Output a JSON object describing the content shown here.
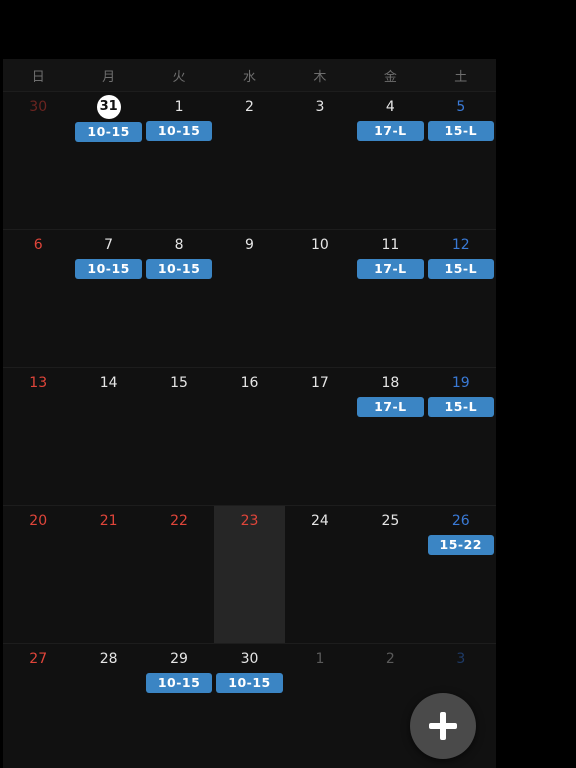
{
  "weekdays": [
    "日",
    "月",
    "火",
    "水",
    "木",
    "金",
    "土"
  ],
  "weeks": [
    [
      {
        "day": "30",
        "type": "other-sun",
        "events": []
      },
      {
        "day": "31",
        "type": "today",
        "events": [
          "10-15"
        ]
      },
      {
        "day": "1",
        "type": "normal",
        "events": [
          "10-15"
        ]
      },
      {
        "day": "2",
        "type": "normal",
        "events": []
      },
      {
        "day": "3",
        "type": "normal",
        "events": []
      },
      {
        "day": "4",
        "type": "normal",
        "events": [
          "17-L"
        ]
      },
      {
        "day": "5",
        "type": "sat",
        "events": [
          "15-L"
        ]
      }
    ],
    [
      {
        "day": "6",
        "type": "sun",
        "events": []
      },
      {
        "day": "7",
        "type": "normal",
        "events": [
          "10-15"
        ]
      },
      {
        "day": "8",
        "type": "normal",
        "events": [
          "10-15"
        ]
      },
      {
        "day": "9",
        "type": "normal",
        "events": []
      },
      {
        "day": "10",
        "type": "normal",
        "events": []
      },
      {
        "day": "11",
        "type": "normal",
        "events": [
          "17-L"
        ]
      },
      {
        "day": "12",
        "type": "sat",
        "events": [
          "15-L"
        ]
      }
    ],
    [
      {
        "day": "13",
        "type": "sun",
        "events": []
      },
      {
        "day": "14",
        "type": "normal",
        "events": []
      },
      {
        "day": "15",
        "type": "normal",
        "events": []
      },
      {
        "day": "16",
        "type": "normal",
        "events": []
      },
      {
        "day": "17",
        "type": "normal",
        "events": []
      },
      {
        "day": "18",
        "type": "normal",
        "events": [
          "17-L"
        ]
      },
      {
        "day": "19",
        "type": "sat",
        "events": [
          "15-L"
        ]
      }
    ],
    [
      {
        "day": "20",
        "type": "sun",
        "events": []
      },
      {
        "day": "21",
        "type": "holiday",
        "events": []
      },
      {
        "day": "22",
        "type": "holiday",
        "events": []
      },
      {
        "day": "23",
        "type": "holiday",
        "highlight": true,
        "events": []
      },
      {
        "day": "24",
        "type": "normal",
        "events": []
      },
      {
        "day": "25",
        "type": "normal",
        "events": []
      },
      {
        "day": "26",
        "type": "sat",
        "events": [
          "15-22"
        ]
      }
    ],
    [
      {
        "day": "27",
        "type": "sun",
        "events": []
      },
      {
        "day": "28",
        "type": "normal",
        "events": []
      },
      {
        "day": "29",
        "type": "normal",
        "events": [
          "10-15"
        ]
      },
      {
        "day": "30",
        "type": "normal",
        "events": [
          "10-15"
        ]
      },
      {
        "day": "1",
        "type": "other",
        "events": []
      },
      {
        "day": "2",
        "type": "other",
        "events": []
      },
      {
        "day": "3",
        "type": "other-sat",
        "events": []
      }
    ]
  ],
  "colors": {
    "event": "#3b85c4",
    "sunday": "#e0453a",
    "saturday": "#3a7ad6",
    "today_bg": "#ffffff",
    "fab_bg": "#4a4a4a"
  },
  "fab": {
    "icon": "plus-icon"
  }
}
